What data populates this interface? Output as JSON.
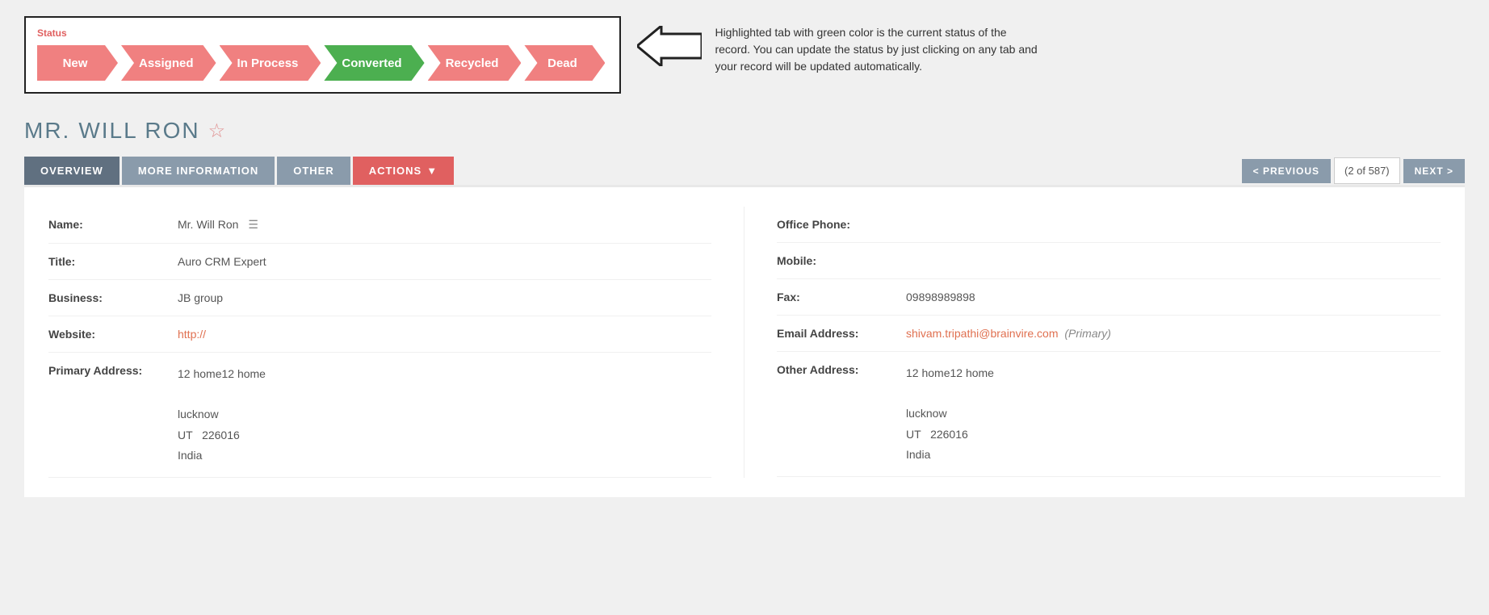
{
  "status": {
    "label": "Status",
    "steps": [
      {
        "id": "new",
        "label": "New",
        "active": false
      },
      {
        "id": "assigned",
        "label": "Assigned",
        "active": false
      },
      {
        "id": "in-process",
        "label": "In Process",
        "active": false
      },
      {
        "id": "converted",
        "label": "Converted",
        "active": true
      },
      {
        "id": "recycled",
        "label": "Recycled",
        "active": false
      },
      {
        "id": "dead",
        "label": "Dead",
        "active": false
      }
    ],
    "note": "Highlighted tab with green color is the current status of the record. You can update the status by just clicking on any tab and your record will be updated automatically."
  },
  "record": {
    "salutation": "MR.",
    "name": "WILL RON"
  },
  "tabs": {
    "overview": "OVERVIEW",
    "more_information": "MORE INFORMATION",
    "other": "OTHER",
    "actions": "ACTIONS",
    "previous": "< PREVIOUS",
    "next": "NEXT >",
    "pagination": "(2 of 587)"
  },
  "fields": {
    "left": [
      {
        "label": "Name:",
        "value": "Mr. Will Ron",
        "type": "name"
      },
      {
        "label": "Title:",
        "value": "Auro CRM Expert",
        "type": "text"
      },
      {
        "label": "Business:",
        "value": "JB group",
        "type": "text"
      },
      {
        "label": "Website:",
        "value": "http://",
        "type": "link"
      },
      {
        "label": "Primary Address:",
        "value": "12 home12 home\n\nlucknow\nUT  226016\nIndia",
        "type": "address"
      }
    ],
    "right": [
      {
        "label": "Office Phone:",
        "value": "",
        "type": "text"
      },
      {
        "label": "Mobile:",
        "value": "",
        "type": "text"
      },
      {
        "label": "Fax:",
        "value": "09898989898",
        "type": "text"
      },
      {
        "label": "Email Address:",
        "value": "shivam.tripathi@brainvire.com",
        "tag": "(Primary)",
        "type": "email"
      },
      {
        "label": "Other Address:",
        "value": "12 home12 home\n\nlucknow\nUT  226016\nIndia",
        "type": "address"
      }
    ]
  }
}
